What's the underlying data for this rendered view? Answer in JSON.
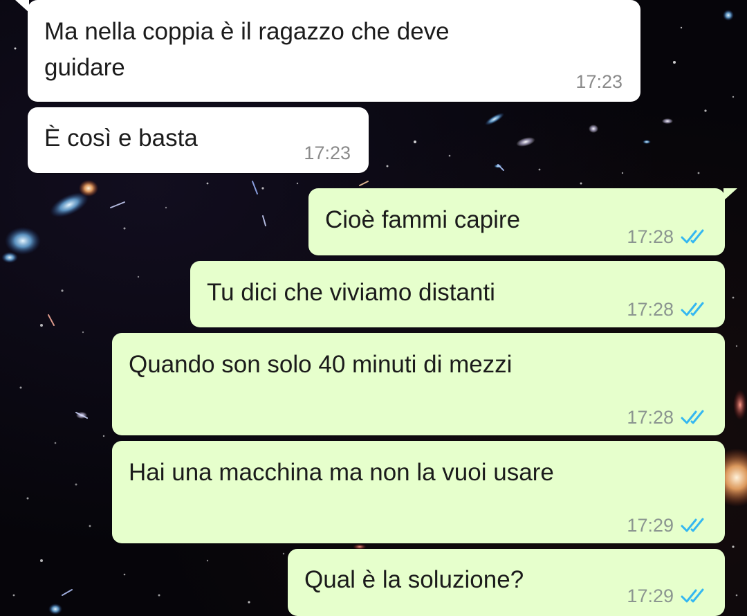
{
  "messages": [
    {
      "text": "Ma nella coppia è il ragazzo che deve\nguidare",
      "time": "17:23"
    },
    {
      "text": "È così e basta",
      "time": "17:23"
    },
    {
      "text": "Cioè fammi capire",
      "time": "17:28",
      "status": "read"
    },
    {
      "text": "Tu dici che viviamo distanti",
      "time": "17:28",
      "status": "read"
    },
    {
      "text": "Quando son solo 40 minuti di mezzi",
      "time": "17:28",
      "status": "read"
    },
    {
      "text": "Hai una macchina ma non la vuoi usare",
      "time": "17:29",
      "status": "read"
    },
    {
      "text": "Qual è la soluzione?",
      "time": "17:29",
      "status": "read"
    }
  ],
  "icons": {
    "read_receipt": "double-check-icon"
  },
  "colors": {
    "incoming_bubble": "#ffffff",
    "outgoing_bubble": "#e6ffcc",
    "read_receipt": "#34b7f1",
    "background": "#06050a"
  }
}
